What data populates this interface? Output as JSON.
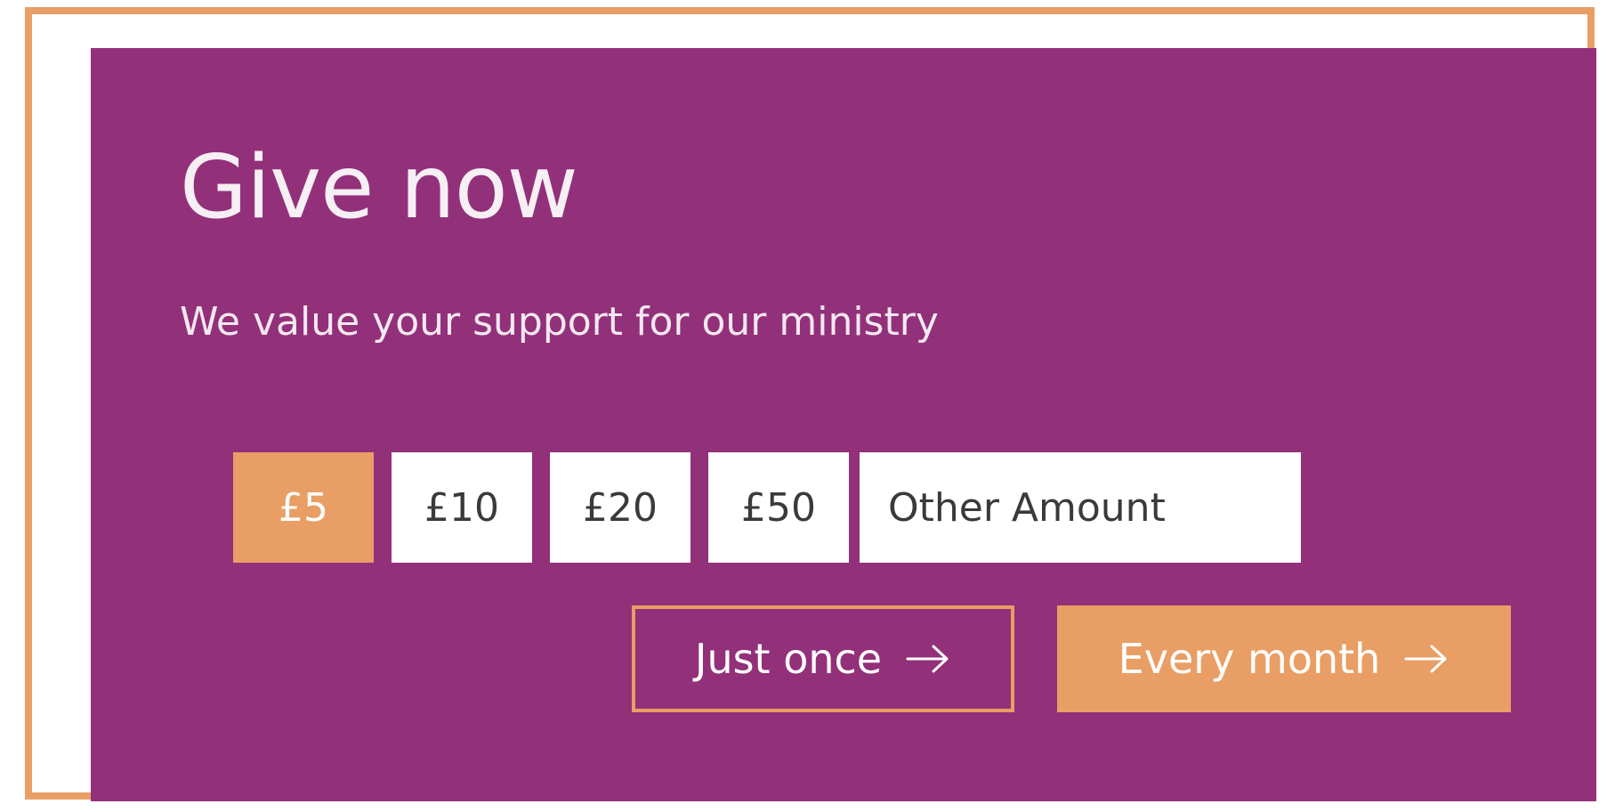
{
  "panel": {
    "title": "Give now",
    "subtitle": "We value your support for our ministry"
  },
  "amounts": {
    "options": [
      "£5",
      "£10",
      "£20",
      "£50"
    ],
    "selected": "£5",
    "other_placeholder": "Other Amount"
  },
  "frequency": {
    "once_label": "Just once",
    "monthly_label": "Every month",
    "icon": "arrow-right-icon"
  },
  "colors": {
    "panel_background": "#93307A",
    "accent": "#E89E64",
    "option_background": "#FFFFFF"
  }
}
